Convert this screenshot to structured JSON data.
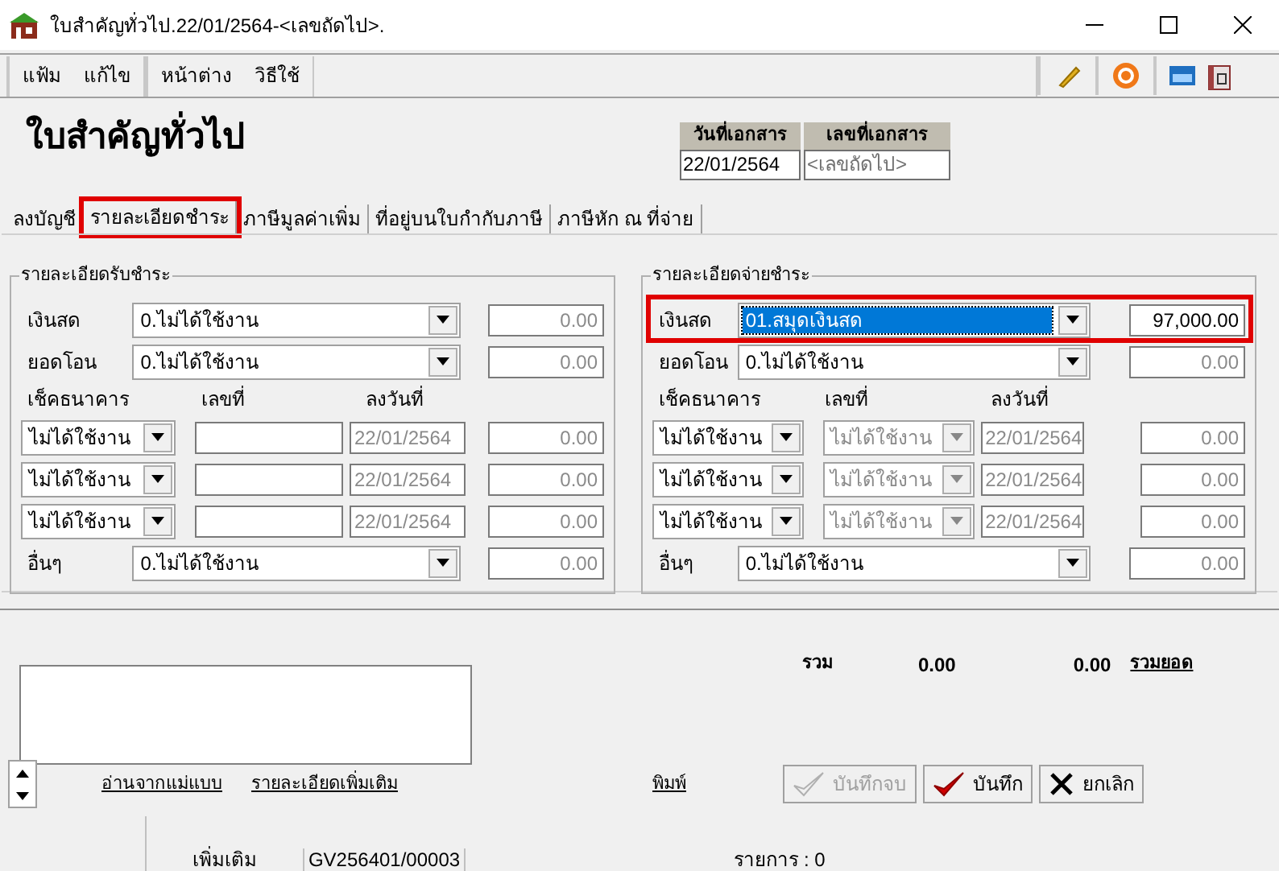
{
  "window": {
    "title": "ใบสำคัญทั่วไป.22/01/2564-<เลขถัดไป>."
  },
  "menu": [
    [
      "แฟ้ม",
      "แก้ไข"
    ],
    [
      "หน้าต่าง",
      "วิธีใช้"
    ]
  ],
  "heading": "ใบสำคัญทั่วไป",
  "doc_fields": [
    {
      "label": "วันที่เอกสาร",
      "value": "22/01/2564",
      "kind": "value"
    },
    {
      "label": "เลขที่เอกสาร",
      "placeholder": "<เลขถัดไป>",
      "kind": "placeholder"
    }
  ],
  "tabs": [
    {
      "label": "ลงบัญชี",
      "selected": false,
      "highlighted": false
    },
    {
      "label": "รายละเอียดชำระ",
      "selected": true,
      "highlighted": true
    },
    {
      "label": "ภาษีมูลค่าเพิ่ม",
      "selected": false,
      "highlighted": false
    },
    {
      "label": "ที่อยู่บนใบกำกับภาษี",
      "selected": false,
      "highlighted": false
    },
    {
      "label": "ภาษีหัก ณ ที่จ่าย",
      "selected": false,
      "highlighted": false
    }
  ],
  "panels": [
    {
      "title": "รายละเอียดรับชำระ",
      "kind": "receive",
      "rows": [
        {
          "kind": "select",
          "label": "เงินสด",
          "value": "0.ไม่ได้ใช้งาน",
          "amount": "0.00",
          "active": false,
          "highlighted": false
        },
        {
          "kind": "select",
          "label": "ยอดโอน",
          "value": "0.ไม่ได้ใช้งาน",
          "amount": "0.00",
          "active": false,
          "highlighted": false
        },
        {
          "kind": "header",
          "columns": [
            "เช็คธนาคาร",
            "เลขที่",
            "ลงวันที่"
          ]
        },
        {
          "kind": "cheque",
          "bank": "ไม่ได้ใช้งาน",
          "date": "22/01/2564",
          "amount": "0.00"
        },
        {
          "kind": "cheque",
          "bank": "ไม่ได้ใช้งาน",
          "date": "22/01/2564",
          "amount": "0.00"
        },
        {
          "kind": "cheque",
          "bank": "ไม่ได้ใช้งาน",
          "date": "22/01/2564",
          "amount": "0.00"
        },
        {
          "kind": "select",
          "label": "อื่นๆ",
          "value": "0.ไม่ได้ใช้งาน",
          "amount": "0.00",
          "active": false,
          "highlighted": false
        }
      ]
    },
    {
      "title": "รายละเอียดจ่ายชำระ",
      "kind": "pay",
      "rows": [
        {
          "kind": "select",
          "label": "เงินสด",
          "value": "01.สมุดเงินสด",
          "amount": "97,000.00",
          "active": true,
          "highlighted": true
        },
        {
          "kind": "select",
          "label": "ยอดโอน",
          "value": "0.ไม่ได้ใช้งาน",
          "amount": "0.00",
          "active": false,
          "highlighted": false
        },
        {
          "kind": "header",
          "columns": [
            "เช็คธนาคาร",
            "เลขที่",
            "ลงวันที่"
          ]
        },
        {
          "kind": "cheque",
          "bank": "ไม่ได้ใช้งาน",
          "number": "ไม่ได้ใช้งาน",
          "date": "22/01/2564",
          "amount": "0.00"
        },
        {
          "kind": "cheque",
          "bank": "ไม่ได้ใช้งาน",
          "number": "ไม่ได้ใช้งาน",
          "date": "22/01/2564",
          "amount": "0.00"
        },
        {
          "kind": "cheque",
          "bank": "ไม่ได้ใช้งาน",
          "number": "ไม่ได้ใช้งาน",
          "date": "22/01/2564",
          "amount": "0.00"
        },
        {
          "kind": "select",
          "label": "อื่นๆ",
          "value": "0.ไม่ได้ใช้งาน",
          "amount": "0.00",
          "active": false,
          "highlighted": false
        }
      ]
    }
  ],
  "totals": {
    "label": "รวม",
    "values": [
      "0.00",
      "0.00"
    ],
    "link": "รวมยอด"
  },
  "links": [
    "อ่านจากแม่แบบ",
    "รายละเอียดเพิ่มเติม"
  ],
  "print_link": "พิมพ์",
  "buttons": [
    {
      "label": "บันทึกจบ",
      "kind": "confirm",
      "disabled": true
    },
    {
      "label": "บันทึก",
      "kind": "confirm",
      "disabled": false
    },
    {
      "label": "ยกเลิก",
      "kind": "cancel",
      "disabled": false
    }
  ],
  "status_bar": {
    "mode": "เพิ่มเติม",
    "doc_no": "GV256401/00003",
    "count": "รายการ : 0"
  }
}
